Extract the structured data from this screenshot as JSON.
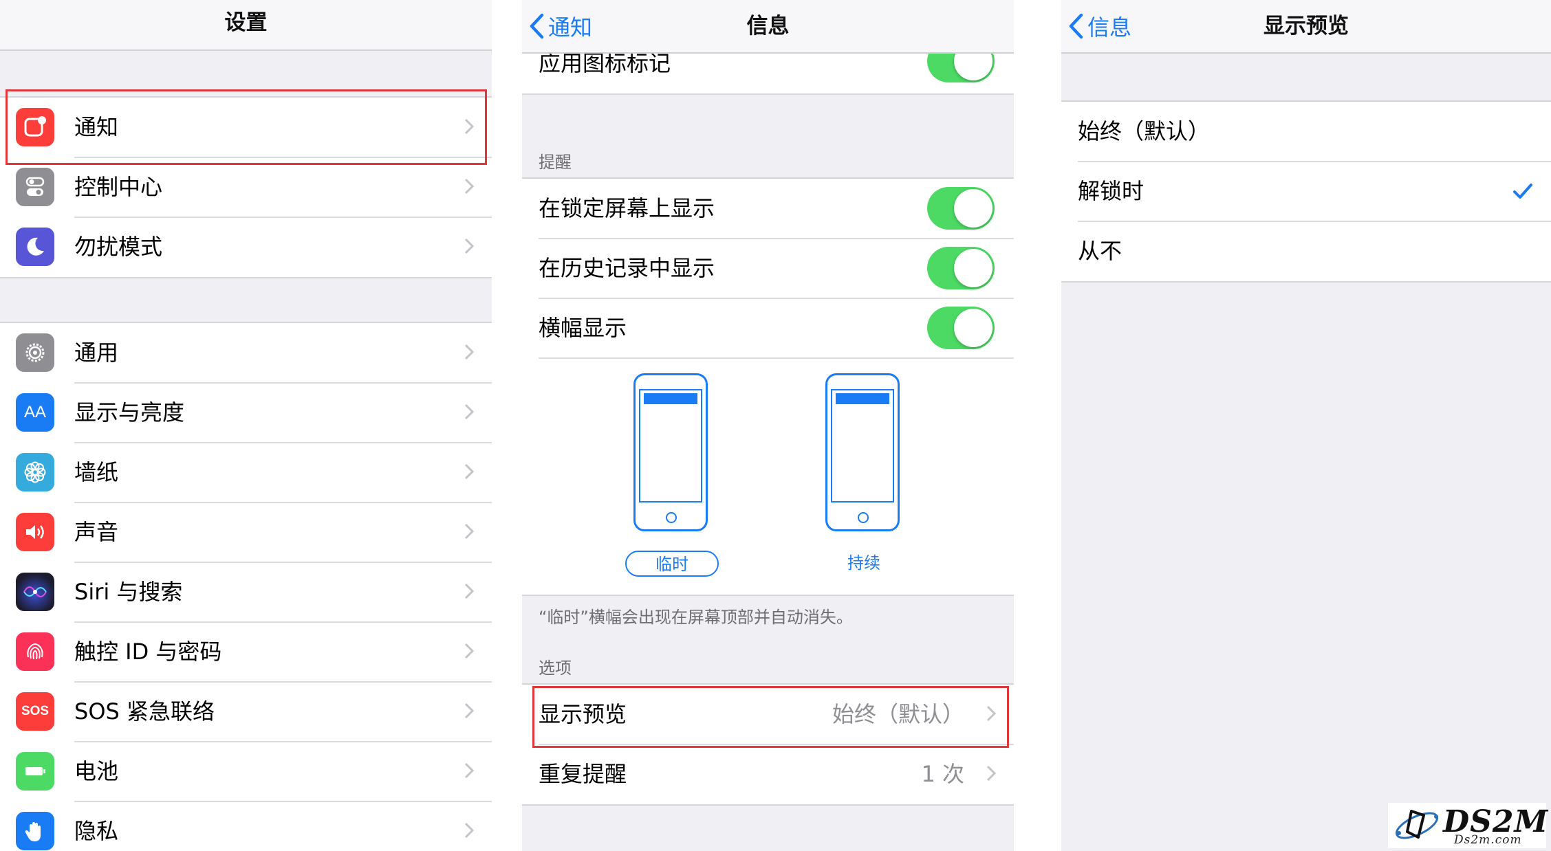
{
  "colors": {
    "accent": "#1a7cf5",
    "toggle_on": "#4cd964",
    "highlight": "#e0383a"
  },
  "settings": {
    "title": "设置",
    "group1": [
      {
        "label": "通知",
        "icon": "notifications-icon",
        "color": "#fc3d39"
      },
      {
        "label": "控制中心",
        "icon": "control-center-icon",
        "color": "#8e8e93"
      },
      {
        "label": "勿扰模式",
        "icon": "moon-icon",
        "color": "#5856d6"
      }
    ],
    "group2": [
      {
        "label": "通用",
        "icon": "gear-icon",
        "color": "#8e8e93"
      },
      {
        "label": "显示与亮度",
        "icon": "display-brightness-icon",
        "color": "#1a7cf5",
        "glyph": "AA"
      },
      {
        "label": "墙纸",
        "icon": "wallpaper-flower-icon",
        "color": "#35aadc"
      },
      {
        "label": "声音",
        "icon": "speaker-icon",
        "color": "#fc3d39"
      },
      {
        "label": "Siri 与搜索",
        "icon": "siri-icon",
        "color": "#1c1c2e"
      },
      {
        "label": "触控 ID 与密码",
        "icon": "fingerprint-icon",
        "color": "#fc3158"
      },
      {
        "label": "SOS 紧急联络",
        "icon": "sos-icon",
        "color": "#fc3d39",
        "glyph": "SOS"
      },
      {
        "label": "电池",
        "icon": "battery-icon",
        "color": "#4cd964"
      },
      {
        "label": "隐私",
        "icon": "privacy-hand-icon",
        "color": "#1a7cf5"
      }
    ]
  },
  "messages": {
    "back": "通知",
    "title": "信息",
    "top_row": "应用图标标记",
    "alerts_header": "提醒",
    "alerts": [
      "在锁定屏幕上显示",
      "在历史记录中显示",
      "横幅显示"
    ],
    "banner_styles": {
      "temporary": "临时",
      "persistent": "持续",
      "selected": "临时"
    },
    "banner_note": "“临时”横幅会出现在屏幕顶部并自动消失。",
    "options_header": "选项",
    "options": [
      {
        "label": "显示预览",
        "value": "始终（默认）"
      },
      {
        "label": "重复提醒",
        "value": "1 次"
      }
    ]
  },
  "preview": {
    "back": "信息",
    "title": "显示预览",
    "choices": [
      "始终（默认）",
      "解锁时",
      "从不"
    ],
    "selected": "解锁时"
  },
  "watermark": {
    "brand": "DS2M",
    "site": "Ds2m.com"
  }
}
